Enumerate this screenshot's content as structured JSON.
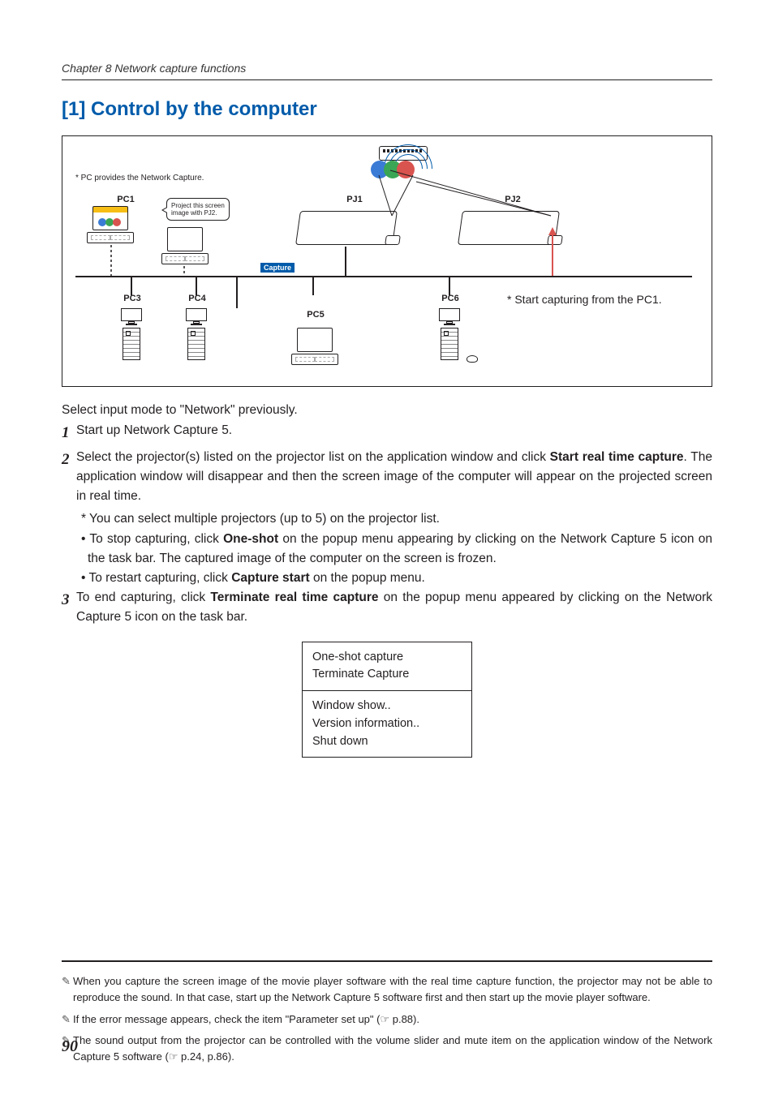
{
  "chapter": "Chapter 8 Network capture functions",
  "section_title": "[1] Control by the computer",
  "diagram": {
    "caption_pc": "* PC provides the Network Capture.",
    "pc1": "PC1",
    "pc3": "PC3",
    "pc4": "PC4",
    "pc5": "PC5",
    "pc6": "PC6",
    "pj1": "PJ1",
    "pj2": "PJ2",
    "balloon": "Project this screen image with PJ2.",
    "capture_tag": "Capture",
    "side_note": "* Start capturing from the PC1."
  },
  "intro": "Select input mode to \"Network\" previously.",
  "steps": {
    "s1": "Start up Network Capture 5.",
    "s2a": "Select the projector(s) listed on the projector list on the application window and click ",
    "s2b_bold": "Start real time capture",
    "s2c": ". The application window will disappear and then the screen image of the computer will appear on the projected screen in real time.",
    "s2_sub1": "* You can select multiple projectors (up to 5) on the projector list.",
    "s2_sub2a": "• To stop capturing, click ",
    "s2_sub2b_bold": "One-shot",
    "s2_sub2c": " on the popup menu appearing by clicking on the Network Capture 5 icon on the task bar. The captured image of the computer on the screen is frozen.",
    "s2_sub3a": "• To restart capturing, click ",
    "s2_sub3b_bold": "Capture start",
    "s2_sub3c": " on the popup menu.",
    "s3a": "To end capturing, click ",
    "s3b_bold": "Terminate real time capture",
    "s3c": " on the popup menu appeared by clicking on the Network Capture 5 icon on the task bar."
  },
  "popup": {
    "i1": "One-shot capture",
    "i2": "Terminate Capture",
    "i3": "Window show..",
    "i4": "Version information..",
    "i5": "Shut down"
  },
  "footnotes": {
    "f1": "When you capture the screen image of the movie player software with the real time capture function, the projector may not be able to reproduce the sound. In that case, start up the Network Capture 5 software first and then start up the movie player software.",
    "f2a": "If the error message appears, check the item \"Parameter set up\"  (",
    "f2b": " p.88).",
    "f3a": "The sound output from the projector can be controlled with the volume slider and mute item on the application window of the Network Capture 5 software (",
    "f3b": " p.24, p.86)."
  },
  "page_number": "90",
  "glyphs": {
    "pen": "✎",
    "pref": "☞"
  }
}
